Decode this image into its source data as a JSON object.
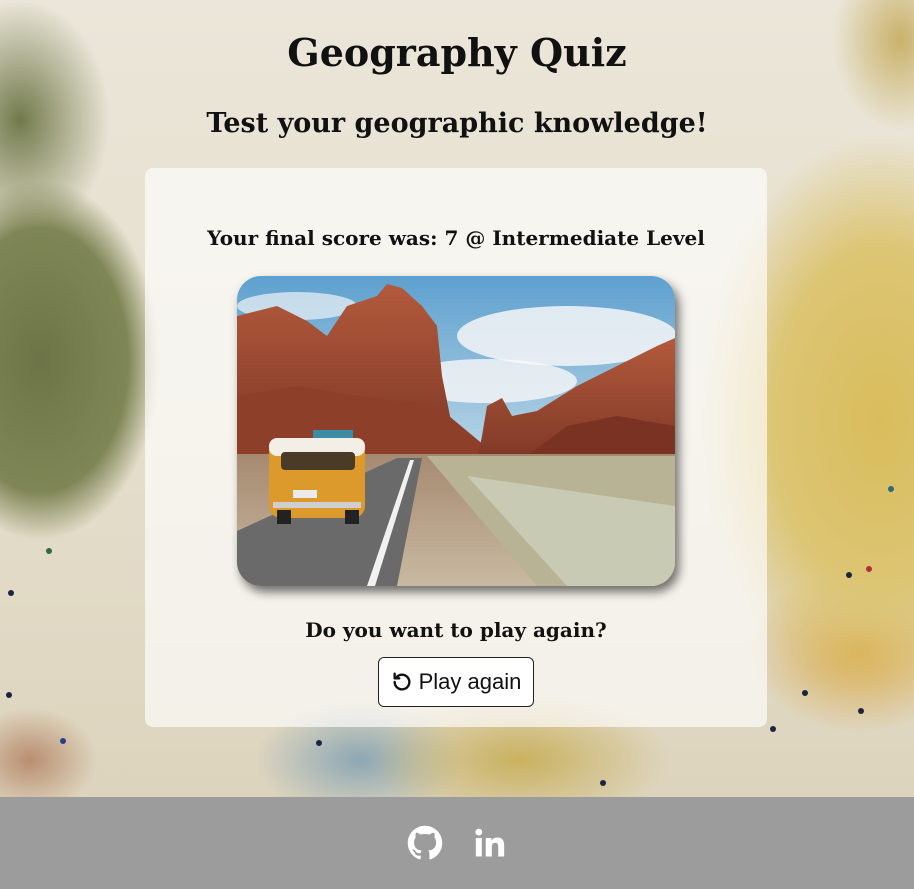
{
  "header": {
    "title": "Geography Quiz",
    "subtitle": "Test your geographic knowledge!"
  },
  "result": {
    "score_text": "Your final score was: 7 @ Intermediate Level",
    "image_subject": "van-on-desert-road-photo",
    "question": "Do you want to play again?",
    "play_again_label": "Play again",
    "play_again_icon": "rotate-left-icon"
  },
  "footer": {
    "links": [
      {
        "icon": "github-icon"
      },
      {
        "icon": "linkedin-icon"
      }
    ],
    "background_color": "#9c9c9c"
  }
}
